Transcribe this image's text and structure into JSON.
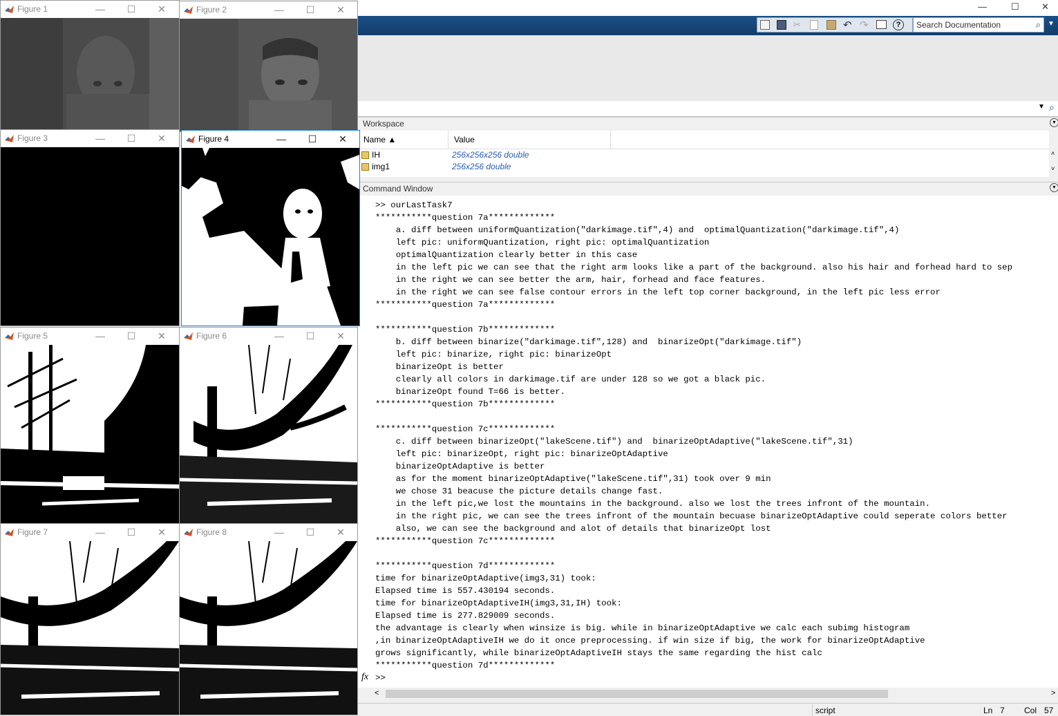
{
  "figures": [
    {
      "title": "Figure 1"
    },
    {
      "title": "Figure 2"
    },
    {
      "title": "Figure 3"
    },
    {
      "title": "Figure 4"
    },
    {
      "title": "Figure 5"
    },
    {
      "title": "Figure 6"
    },
    {
      "title": "Figure 7"
    },
    {
      "title": "Figure 8"
    }
  ],
  "window_controls": {
    "minimize": "—",
    "maximize": "☐",
    "close": "✕"
  },
  "toolbar": {
    "search_placeholder": "Search Documentation",
    "icons": [
      "new-script-icon",
      "save-icon",
      "cut-icon",
      "copy-icon",
      "paste-icon",
      "undo-icon",
      "redo-icon",
      "switch-windows-icon",
      "help-icon"
    ]
  },
  "workspace": {
    "title": "Workspace",
    "columns": {
      "name": "Name ▲",
      "value": "Value"
    },
    "rows": [
      {
        "name": "IH",
        "value": "256x256x256 double"
      },
      {
        "name": "img1",
        "value": "256x256 double"
      }
    ]
  },
  "command_window": {
    "title": "Command Window",
    "prompt": ">>",
    "fx": "fx",
    "lines": [
      ">> ourLastTask7",
      "***********question 7a*************",
      "    a. diff between uniformQuantization(\"darkimage.tif\",4) and  optimalQuantization(\"darkimage.tif\",4)",
      "    left pic: uniformQuantization, right pic: optimalQuantization",
      "    optimalQuantization clearly better in this case",
      "    in the left pic we can see that the right arm looks like a part of the background. also his hair and forhead hard to sep",
      "    in the right we can see better the arm, hair, forhead and face features.",
      "    in the right we can see false contour errors in the left top corner background, in the left pic less error",
      "***********question 7a*************",
      "",
      "***********question 7b*************",
      "    b. diff between binarize(\"darkimage.tif\",128) and  binarizeOpt(\"darkimage.tif\")",
      "    left pic: binarize, right pic: binarizeOpt",
      "    binarizeOpt is better",
      "    clearly all colors in darkimage.tif are under 128 so we got a black pic.",
      "    binarizeOpt found T=66 is better.",
      "***********question 7b*************",
      "",
      "***********question 7c*************",
      "    c. diff between binarizeOpt(\"lakeScene.tif\") and  binarizeOptAdaptive(\"lakeScene.tif\",31)",
      "    left pic: binarizeOpt, right pic: binarizeOptAdaptive",
      "    binarizeOptAdaptive is better",
      "    as for the moment binarizeOptAdaptive(\"lakeScene.tif\",31) took over 9 min",
      "    we chose 31 beacuse the picture details change fast.",
      "    in the left pic,we lost the mountains in the background. also we lost the trees infront of the mountain.",
      "    in the right pic, we can see the trees infront of the mountain becuase binarizeOptAdaptive could seperate colors better",
      "    also, we can see the background and alot of details that binarizeOpt lost",
      "***********question 7c*************",
      "",
      "***********question 7d*************",
      "time for binarizeOptAdaptive(img3,31) took:",
      "Elapsed time is 557.430194 seconds.",
      "time for binarizeOptAdaptiveIH(img3,31,IH) took:",
      "Elapsed time is 277.829009 seconds.",
      "the advantage is clearly when winsize is big. while in binarizeOptAdaptive we calc each subimg histogram",
      ",in binarizeOptAdaptiveIH we do it once preprocessing. if win size if big, the work for binarizeOptAdaptive",
      "grows significantly, while binarizeOptAdaptiveIH stays the same regarding the hist calc",
      "***********question 7d*************"
    ]
  },
  "status_bar": {
    "mode": "script",
    "ln_label": "Ln",
    "ln": "7",
    "col_label": "Col",
    "col": "57"
  },
  "colors": {
    "ribbon": "#1b4f86",
    "link_value": "#2a5db0",
    "active_border": "#1d7fd1"
  }
}
